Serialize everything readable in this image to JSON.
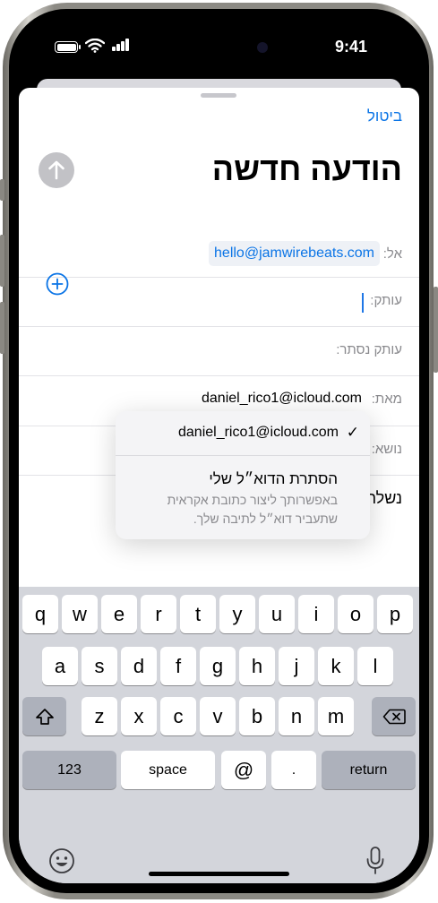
{
  "status": {
    "time": "9:41"
  },
  "compose": {
    "cancel_label": "ביטול",
    "title": "הודעה חדשה",
    "to_label": "אל:",
    "to_recipient": "hello@jamwirebeats.com",
    "cc_label": "עותק:",
    "bcc_label": "עותק נסתר:",
    "from_label": "מאת:",
    "from_value": "daniel_rico1@icloud.com",
    "subject_label": "נושא:",
    "body_text": "נשלח"
  },
  "from_menu": {
    "selected_email": "daniel_rico1@icloud.com",
    "check": "✓",
    "hide_title": "הסתרת הדוא״ל שלי",
    "hide_desc": "באפשרותך ליצור כתובת אקראית שתעביר דוא״ל לתיבה שלך."
  },
  "keyboard": {
    "row1": [
      "q",
      "w",
      "e",
      "r",
      "t",
      "y",
      "u",
      "i",
      "o",
      "p"
    ],
    "row2": [
      "a",
      "s",
      "d",
      "f",
      "g",
      "h",
      "j",
      "k",
      "l"
    ],
    "row3": [
      "z",
      "x",
      "c",
      "v",
      "b",
      "n",
      "m"
    ],
    "numbers_label": "123",
    "space_label": "space",
    "at_label": "@",
    "dot_label": ".",
    "return_label": "return"
  },
  "colors": {
    "accent": "#0a74e6",
    "keyboard_bg": "#d3d5db"
  }
}
